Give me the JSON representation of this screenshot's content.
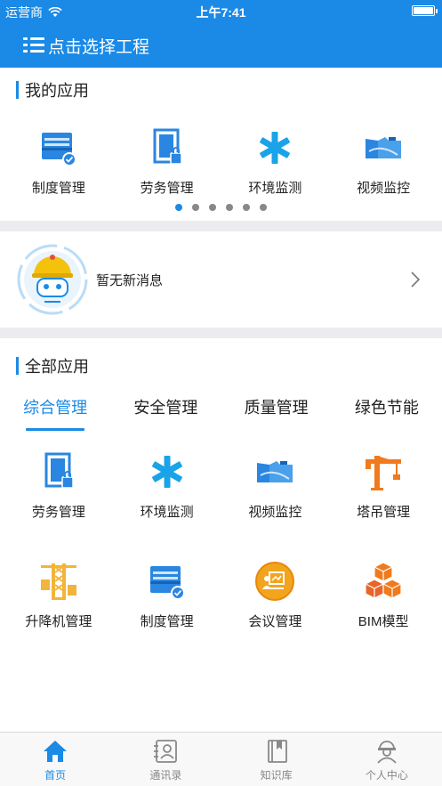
{
  "status_bar": {
    "carrier": "运营商",
    "time": "上午7:41"
  },
  "header": {
    "title": "点击选择工程"
  },
  "my_apps": {
    "title": "我的应用",
    "items": [
      {
        "label": "制度管理",
        "icon": "system-management-icon"
      },
      {
        "label": "劳务管理",
        "icon": "labor-management-icon"
      },
      {
        "label": "环境监测",
        "icon": "environment-monitoring-icon"
      },
      {
        "label": "视频监控",
        "icon": "video-monitoring-icon"
      }
    ],
    "page_count": 6,
    "active_page": 0
  },
  "messages": {
    "text": "暂无新消息"
  },
  "all_apps": {
    "title": "全部应用",
    "tabs": [
      {
        "label": "综合管理",
        "active": true
      },
      {
        "label": "安全管理",
        "active": false
      },
      {
        "label": "质量管理",
        "active": false
      },
      {
        "label": "绿色节能",
        "active": false
      }
    ],
    "items": [
      {
        "label": "劳务管理",
        "icon": "labor-management-icon"
      },
      {
        "label": "环境监测",
        "icon": "environment-monitoring-icon"
      },
      {
        "label": "视频监控",
        "icon": "video-monitoring-icon"
      },
      {
        "label": "塔吊管理",
        "icon": "tower-crane-icon"
      },
      {
        "label": "升降机管理",
        "icon": "elevator-icon"
      },
      {
        "label": "制度管理",
        "icon": "system-management-icon"
      },
      {
        "label": "会议管理",
        "icon": "meeting-icon"
      },
      {
        "label": "BIM模型",
        "icon": "bim-model-icon"
      }
    ]
  },
  "bottom_nav": {
    "items": [
      {
        "label": "首页",
        "icon": "home-icon",
        "active": true
      },
      {
        "label": "通讯录",
        "icon": "contacts-icon",
        "active": false
      },
      {
        "label": "知识库",
        "icon": "knowledge-icon",
        "active": false
      },
      {
        "label": "个人中心",
        "icon": "profile-icon",
        "active": false
      }
    ]
  },
  "colors": {
    "primary": "#1a8ae6",
    "accent_orange": "#f07a1e",
    "accent_yellow": "#f2b43a",
    "cyan": "#1aa3e8"
  }
}
